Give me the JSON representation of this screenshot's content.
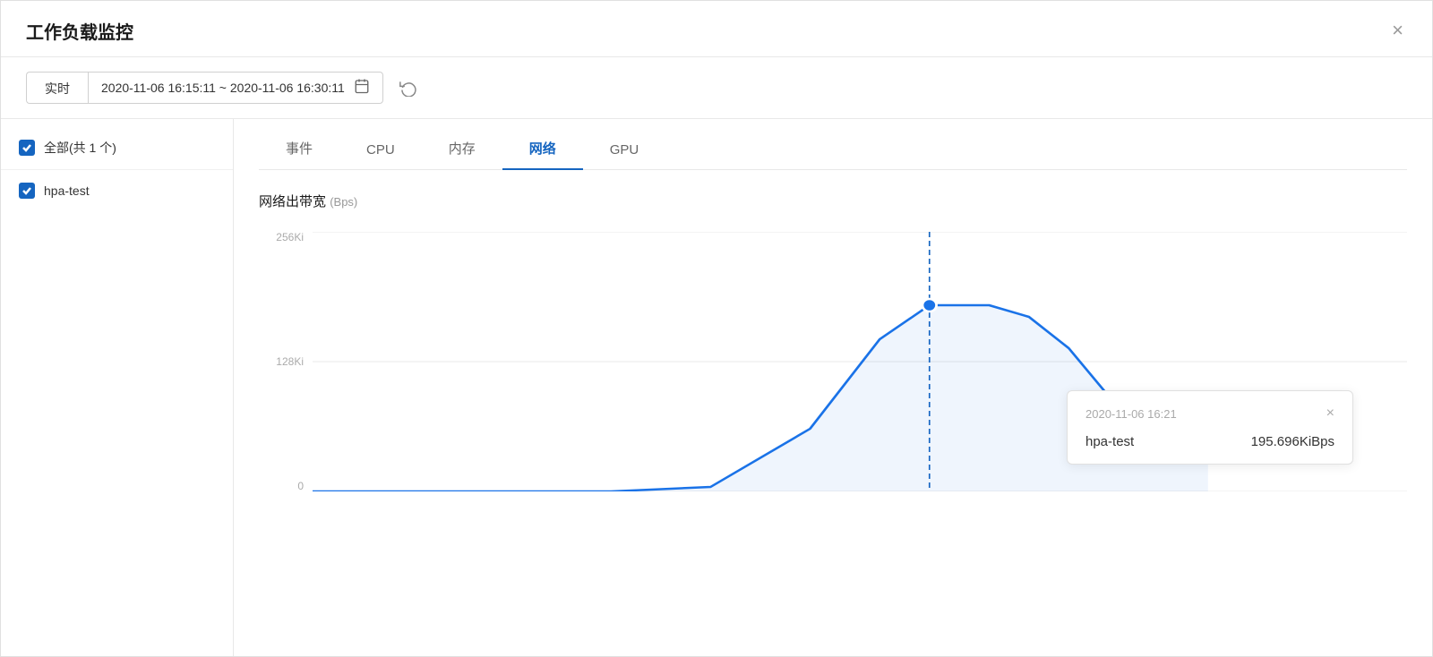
{
  "dialog": {
    "title": "工作负载监控",
    "close_label": "×"
  },
  "toolbar": {
    "realtime_label": "实时",
    "datetime_range": "2020-11-06 16:15:11 ~ 2020-11-06 16:30:11",
    "calendar_icon": "📅",
    "refresh_icon": "↻"
  },
  "sidebar": {
    "items": [
      {
        "id": "all",
        "label": "全部(共 1 个)",
        "checked": true
      },
      {
        "id": "hpa-test",
        "label": "hpa-test",
        "checked": true
      }
    ]
  },
  "tabs": [
    {
      "id": "events",
      "label": "事件",
      "active": false
    },
    {
      "id": "cpu",
      "label": "CPU",
      "active": false
    },
    {
      "id": "memory",
      "label": "内存",
      "active": false
    },
    {
      "id": "network",
      "label": "网络",
      "active": true
    },
    {
      "id": "gpu",
      "label": "GPU",
      "active": false
    }
  ],
  "chart": {
    "title": "网络出带宽",
    "unit": "(Bps)",
    "y_labels": [
      "256Ki",
      "128Ki",
      "0"
    ],
    "tooltip": {
      "time": "2020-11-06 16:21",
      "name": "hpa-test",
      "value": "195.696KiBps",
      "close_label": "×"
    }
  }
}
